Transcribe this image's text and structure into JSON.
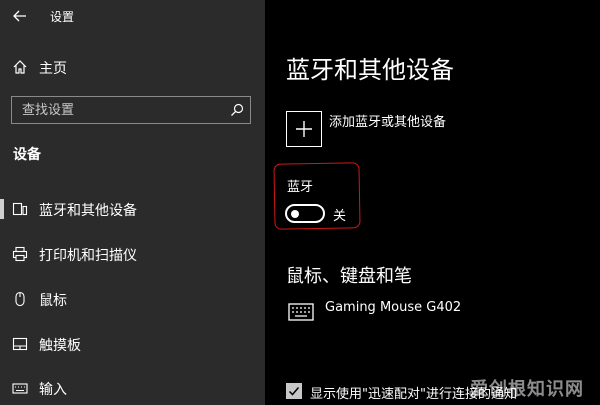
{
  "window": {
    "title": "设置"
  },
  "sidebar": {
    "home_label": "主页",
    "search": {
      "placeholder": "查找设置"
    },
    "section_title": "设备",
    "items": [
      {
        "label": "蓝牙和其他设备",
        "icon": "bluetooth-devices-icon",
        "selected": true
      },
      {
        "label": "打印机和扫描仪",
        "icon": "printer-icon"
      },
      {
        "label": "鼠标",
        "icon": "mouse-icon"
      },
      {
        "label": "触摸板",
        "icon": "touchpad-icon"
      },
      {
        "label": "输入",
        "icon": "keyboard-icon"
      }
    ]
  },
  "main": {
    "title": "蓝牙和其他设备",
    "add_device_label": "添加蓝牙或其他设备",
    "bluetooth": {
      "heading": "蓝牙",
      "state_label": "关",
      "on": false
    },
    "mice_section": {
      "title": "鼠标、键盘和笔",
      "devices": [
        {
          "name": "Gaming Mouse G402",
          "icon": "keyboard-icon"
        }
      ]
    },
    "swift_pair": {
      "label": "显示使用\"迅速配对\"进行连接的通知",
      "checked": true
    }
  },
  "watermark": "爱创根知识网",
  "colors": {
    "sidebar_bg": "#2b2b2b",
    "main_bg": "#000000",
    "highlight": "#d01818"
  }
}
